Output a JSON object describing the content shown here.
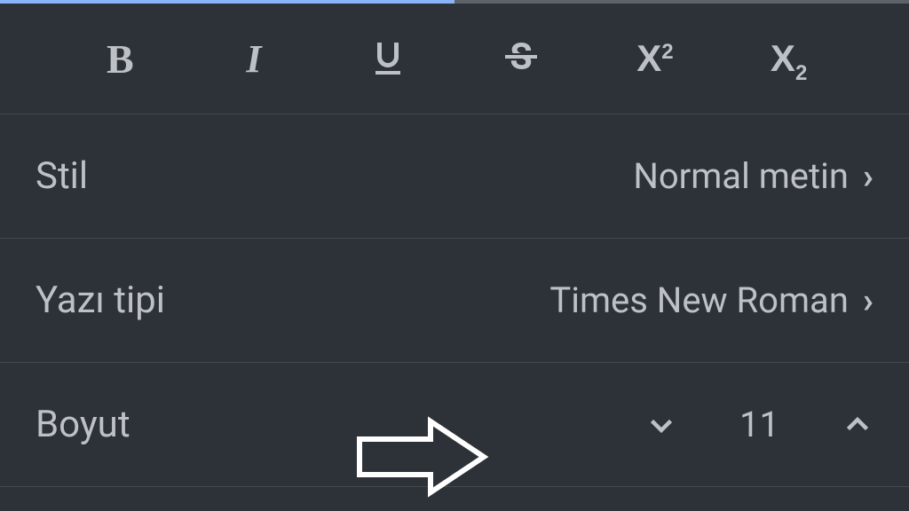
{
  "toolbar": {
    "bold": "B",
    "italic": "I",
    "underline": "U",
    "strikethrough": "S",
    "superscript_base": "X",
    "superscript_index": "2",
    "subscript_base": "X",
    "subscript_index": "2"
  },
  "settings": {
    "style": {
      "label": "Stil",
      "value": "Normal metin"
    },
    "font": {
      "label": "Yazı tipi",
      "value": "Times New Roman"
    },
    "size": {
      "label": "Boyut",
      "value": "11"
    }
  }
}
